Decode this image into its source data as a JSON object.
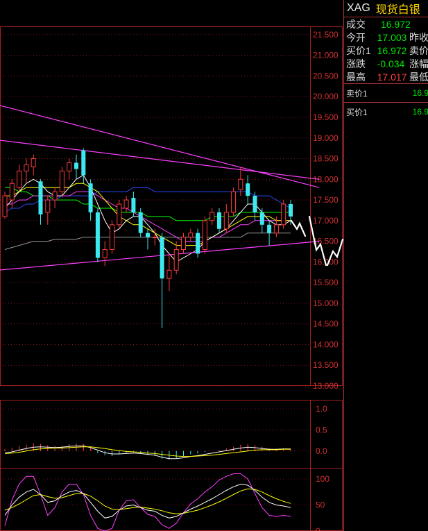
{
  "quote": {
    "code": "XAG",
    "name": "现货白银",
    "rows": [
      {
        "label": "成交",
        "value": "16.972",
        "color": "green",
        "extra": ""
      },
      {
        "label": "今开",
        "value": "17.003",
        "color": "green",
        "extra": "昨收"
      },
      {
        "label": "买价1",
        "value": "16.972",
        "color": "green",
        "extra": "卖价"
      },
      {
        "label": "涨跌",
        "value": "-0.034",
        "color": "green",
        "extra": "涨幅"
      },
      {
        "label": "最高",
        "value": "17.017",
        "color": "red",
        "extra": "最低"
      }
    ],
    "ask1_label": "卖价1",
    "ask1_value": "16.9",
    "bid1_label": "买价1",
    "bid1_value": "16.9"
  },
  "colors": {
    "up": "#ff3b3b",
    "down": "#3ee8f0",
    "grid": "#a32020",
    "ma5": "#ffffff",
    "ma10": "#ffff00",
    "ma20": "#ff40ff",
    "ma30": "#00ff00",
    "ma60": "#2a4aff",
    "ma120": "#999999",
    "trend": "#ff40ff",
    "arrow": "#ffffff"
  },
  "chart_data": {
    "type": "candlestick",
    "y_ticks": [
      "21.500",
      "21.000",
      "20.500",
      "20.000",
      "19.500",
      "19.000",
      "18.500",
      "18.000",
      "17.500",
      "17.000",
      "16.500",
      "16.000",
      "15.500",
      "15.000",
      "14.500",
      "14.000",
      "13.500",
      "13.000"
    ],
    "ylim": [
      13.0,
      21.7
    ],
    "candles": [
      [
        17.1,
        17.6,
        17.05,
        17.7
      ],
      [
        17.5,
        17.9,
        17.3,
        18.0
      ],
      [
        17.8,
        18.2,
        17.7,
        18.35
      ],
      [
        18.2,
        18.35,
        17.9,
        18.5
      ],
      [
        18.3,
        18.5,
        18.1,
        18.6
      ],
      [
        17.95,
        17.15,
        16.9,
        18.0
      ],
      [
        17.2,
        17.5,
        16.9,
        17.6
      ],
      [
        17.5,
        17.7,
        17.3,
        17.8
      ],
      [
        17.7,
        18.2,
        17.6,
        18.3
      ],
      [
        18.2,
        18.4,
        18.0,
        18.5
      ],
      [
        18.4,
        18.25,
        18.0,
        18.6
      ],
      [
        18.7,
        18.1,
        17.9,
        18.75
      ],
      [
        17.9,
        17.2,
        17.0,
        18.0
      ],
      [
        17.2,
        16.1,
        16.0,
        17.3
      ],
      [
        16.1,
        16.3,
        15.9,
        16.5
      ],
      [
        16.3,
        16.9,
        16.2,
        17.0
      ],
      [
        16.9,
        17.4,
        16.8,
        17.5
      ],
      [
        17.3,
        17.5,
        17.2,
        17.6
      ],
      [
        17.55,
        17.2,
        17.1,
        17.7
      ],
      [
        17.2,
        16.7,
        16.6,
        17.3
      ],
      [
        16.7,
        16.6,
        16.3,
        16.8
      ],
      [
        16.6,
        16.6,
        16.4,
        16.8
      ],
      [
        16.6,
        15.6,
        14.4,
        16.7
      ],
      [
        15.6,
        15.8,
        15.3,
        16.2
      ],
      [
        15.8,
        16.3,
        15.7,
        16.5
      ],
      [
        16.3,
        16.6,
        16.2,
        16.7
      ],
      [
        16.6,
        16.7,
        16.5,
        16.8
      ],
      [
        16.7,
        16.2,
        16.1,
        16.8
      ],
      [
        16.3,
        17.0,
        16.2,
        17.1
      ],
      [
        17.0,
        17.2,
        16.9,
        17.3
      ],
      [
        17.2,
        16.8,
        16.7,
        17.3
      ],
      [
        16.8,
        17.2,
        16.7,
        17.4
      ],
      [
        17.2,
        17.7,
        17.1,
        17.8
      ],
      [
        17.75,
        18.0,
        17.6,
        18.3
      ],
      [
        17.9,
        17.6,
        17.4,
        18.1
      ],
      [
        17.6,
        17.2,
        17.0,
        17.7
      ],
      [
        17.2,
        16.9,
        16.7,
        17.3
      ],
      [
        16.9,
        16.7,
        16.4,
        17.0
      ],
      [
        16.7,
        16.9,
        16.6,
        17.1
      ],
      [
        16.9,
        17.4,
        16.8,
        17.5
      ],
      [
        17.4,
        17.1,
        16.9,
        17.5
      ]
    ],
    "ma5": [
      17.3,
      17.5,
      17.7,
      17.9,
      18.0,
      17.9,
      17.7,
      17.6,
      17.6,
      17.8,
      18.0,
      18.1,
      17.8,
      17.4,
      17.0,
      16.7,
      16.8,
      17.0,
      17.1,
      17.1,
      16.9,
      16.7,
      16.4,
      16.2,
      16.0,
      16.1,
      16.2,
      16.3,
      16.5,
      16.6,
      16.7,
      16.8,
      17.0,
      17.2,
      17.4,
      17.4,
      17.2,
      17.0,
      16.9,
      16.9,
      17.0
    ],
    "ma10": [
      17.6,
      17.6,
      17.7,
      17.8,
      17.8,
      17.8,
      17.8,
      17.8,
      17.8,
      17.8,
      17.9,
      17.9,
      17.8,
      17.7,
      17.5,
      17.3,
      17.1,
      17.0,
      16.9,
      16.9,
      16.8,
      16.7,
      16.6,
      16.5,
      16.4,
      16.4,
      16.4,
      16.4,
      16.5,
      16.6,
      16.7,
      16.8,
      16.9,
      17.0,
      17.1,
      17.1,
      17.1,
      17.1,
      17.0,
      17.0,
      17.0
    ],
    "ma20": [
      17.4,
      17.4,
      17.5,
      17.5,
      17.6,
      17.6,
      17.6,
      17.6,
      17.6,
      17.6,
      17.7,
      17.7,
      17.7,
      17.6,
      17.5,
      17.4,
      17.3,
      17.3,
      17.2,
      17.1,
      17.0,
      16.9,
      16.8,
      16.7,
      16.6,
      16.5,
      16.5,
      16.5,
      16.5,
      16.6,
      16.6,
      16.7,
      16.8,
      16.9,
      16.9,
      17.0,
      17.0,
      17.0,
      17.0,
      17.0,
      17.0
    ],
    "ma30": [
      17.8,
      17.8,
      17.7,
      17.7,
      17.6,
      17.6,
      17.6,
      17.5,
      17.5,
      17.5,
      17.5,
      17.4,
      17.4,
      17.3,
      17.3,
      17.3,
      17.2,
      17.2,
      17.2,
      17.2,
      17.1,
      17.1,
      17.1,
      17.1,
      17.0,
      17.0,
      17.0,
      17.0,
      17.0,
      17.1,
      17.1,
      17.1,
      17.1,
      17.2,
      17.2,
      17.2,
      17.2,
      17.2,
      17.2,
      17.2,
      17.2
    ],
    "ma60": [
      17.2,
      17.3,
      17.3,
      17.4,
      17.4,
      17.5,
      17.5,
      17.5,
      17.6,
      17.6,
      17.6,
      17.6,
      17.6,
      17.7,
      17.7,
      17.7,
      17.7,
      17.7,
      17.8,
      17.8,
      17.8,
      17.7,
      17.7,
      17.7,
      17.7,
      17.7,
      17.7,
      17.7,
      17.7,
      17.7,
      17.7,
      17.7,
      17.7,
      17.7,
      17.7,
      17.6,
      17.6,
      17.6,
      17.5,
      17.4,
      17.3
    ],
    "ma120": [
      16.3,
      16.35,
      16.4,
      16.45,
      16.5,
      16.5,
      16.5,
      16.55,
      16.55,
      16.55,
      16.55,
      16.6,
      16.6,
      16.6,
      16.6,
      16.6,
      16.6,
      16.6,
      16.6,
      16.6,
      16.6,
      16.6,
      16.6,
      16.6,
      16.6,
      16.6,
      16.6,
      16.6,
      16.6,
      16.6,
      16.6,
      16.6,
      16.6,
      16.6,
      16.7,
      16.7,
      16.7,
      16.7,
      16.7,
      16.7,
      16.7
    ],
    "trendlines": [
      {
        "p1": [
          -1,
          19.8
        ],
        "p2": [
          44,
          17.8
        ]
      },
      {
        "p1": [
          -1,
          18.95
        ],
        "p2": [
          44,
          18.0
        ]
      },
      {
        "p1": [
          -1,
          15.8
        ],
        "p2": [
          44,
          16.5
        ]
      }
    ],
    "macd": {
      "y_ticks": [
        "1.0",
        "0.5",
        "0.0"
      ],
      "ylim": [
        -0.4,
        1.2
      ],
      "hist": [
        0.05,
        0.08,
        0.12,
        0.15,
        0.18,
        0.17,
        0.14,
        0.12,
        0.13,
        0.16,
        0.18,
        0.17,
        0.1,
        -0.05,
        -0.1,
        -0.12,
        -0.08,
        -0.04,
        -0.02,
        -0.05,
        -0.09,
        -0.12,
        -0.18,
        -0.2,
        -0.17,
        -0.12,
        -0.08,
        -0.06,
        -0.03,
        0.0,
        0.03,
        0.06,
        0.1,
        0.15,
        0.17,
        0.14,
        0.1,
        0.06,
        0.05,
        0.06,
        0.05
      ],
      "dif": [
        -0.05,
        -0.02,
        0.02,
        0.06,
        0.09,
        0.1,
        0.09,
        0.08,
        0.09,
        0.11,
        0.12,
        0.12,
        0.08,
        0.02,
        -0.04,
        -0.07,
        -0.07,
        -0.06,
        -0.05,
        -0.06,
        -0.08,
        -0.1,
        -0.15,
        -0.18,
        -0.18,
        -0.16,
        -0.13,
        -0.11,
        -0.08,
        -0.05,
        -0.02,
        0.01,
        0.04,
        0.07,
        0.09,
        0.08,
        0.06,
        0.04,
        0.04,
        0.05,
        0.05
      ],
      "dea": [
        -0.06,
        -0.05,
        -0.03,
        0.0,
        0.03,
        0.05,
        0.06,
        0.07,
        0.07,
        0.08,
        0.09,
        0.1,
        0.1,
        0.08,
        0.06,
        0.03,
        0.01,
        -0.01,
        -0.02,
        -0.03,
        -0.05,
        -0.06,
        -0.08,
        -0.1,
        -0.12,
        -0.13,
        -0.13,
        -0.12,
        -0.11,
        -0.1,
        -0.08,
        -0.06,
        -0.04,
        -0.02,
        0.0,
        0.02,
        0.03,
        0.03,
        0.03,
        0.04,
        0.04
      ]
    },
    "kdj": {
      "y_ticks": [
        "100",
        "50",
        "0"
      ],
      "ylim": [
        0,
        120
      ],
      "k": [
        30,
        50,
        65,
        75,
        80,
        70,
        55,
        58,
        68,
        75,
        78,
        72,
        55,
        38,
        25,
        28,
        40,
        48,
        50,
        45,
        40,
        38,
        30,
        25,
        28,
        35,
        42,
        48,
        55,
        62,
        70,
        78,
        85,
        90,
        88,
        78,
        65,
        55,
        50,
        48,
        45
      ],
      "d": [
        40,
        45,
        52,
        60,
        68,
        70,
        66,
        63,
        64,
        68,
        72,
        72,
        67,
        58,
        48,
        42,
        41,
        43,
        45,
        46,
        44,
        42,
        39,
        35,
        33,
        34,
        37,
        40,
        45,
        50,
        56,
        63,
        70,
        77,
        81,
        80,
        75,
        68,
        62,
        57,
        53
      ],
      "j": [
        10,
        60,
        90,
        105,
        105,
        70,
        30,
        45,
        75,
        90,
        90,
        70,
        30,
        5,
        0,
        5,
        40,
        58,
        60,
        45,
        32,
        28,
        12,
        5,
        15,
        35,
        52,
        62,
        75,
        85,
        98,
        105,
        110,
        110,
        100,
        72,
        45,
        30,
        28,
        30,
        28
      ]
    }
  }
}
